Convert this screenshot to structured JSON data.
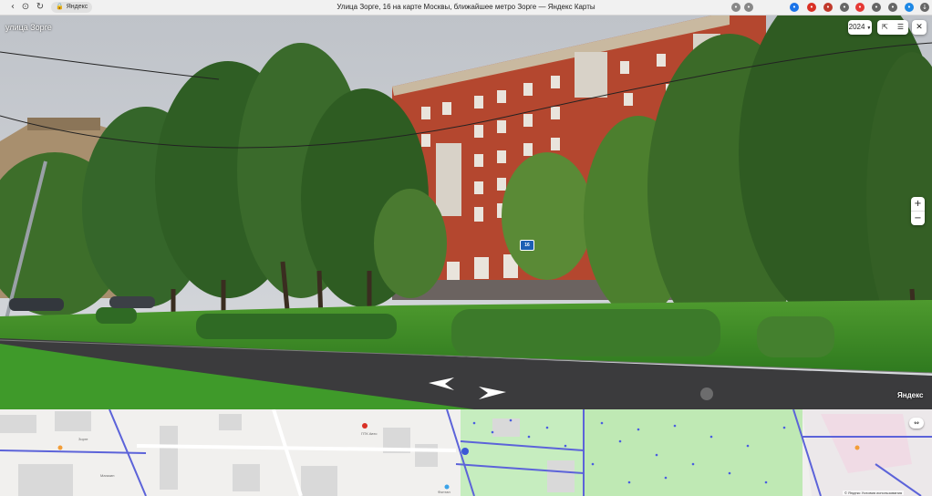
{
  "browser": {
    "tab_label": "Яндекс",
    "page_title": "Улица Зорге, 16 на карте Москвы, ближайшее метро Зорге — Яндекс Карты",
    "nav_icons": [
      "back-icon",
      "forward-icon",
      "reload-icon"
    ],
    "extension_icons": [
      "location-icon",
      "bookmark-icon",
      "translate-icon",
      "adblock-icon",
      "extension-icon",
      "download-icon"
    ]
  },
  "panorama": {
    "street_label": "улица Зорге",
    "house_number": "16",
    "brand": "Яндекс",
    "year": "2024"
  },
  "controls": {
    "year_label": "2024",
    "zoom_in": "+",
    "zoom_out": "−"
  },
  "map": {
    "labels": [
      "Зорге",
      "ПТК Авто",
      "Магазин",
      "Фонтан"
    ],
    "attribution": "© Яндекс  Условия использования"
  },
  "colors": {
    "sky": "#c9ccd1",
    "facade": "#b4472f",
    "grass": "#3f8f2a",
    "road": "#3b3b3d",
    "map_park": "#c8efc0",
    "map_road": "#5c63d9"
  }
}
